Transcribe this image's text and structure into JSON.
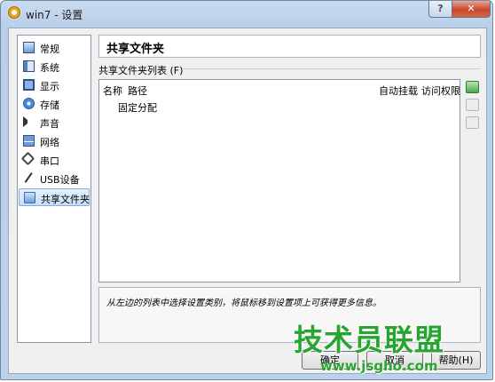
{
  "window": {
    "title": "win7 - 设置",
    "help_label": "?",
    "close_label": "✕"
  },
  "sidebar": {
    "items": [
      {
        "label": "常规",
        "icon": "general-icon"
      },
      {
        "label": "系统",
        "icon": "system-icon"
      },
      {
        "label": "显示",
        "icon": "display-icon"
      },
      {
        "label": "存储",
        "icon": "storage-icon"
      },
      {
        "label": "声音",
        "icon": "audio-icon"
      },
      {
        "label": "网络",
        "icon": "network-icon"
      },
      {
        "label": "串口",
        "icon": "serial-port-icon"
      },
      {
        "label": "USB设备",
        "icon": "usb-icon"
      },
      {
        "label": "共享文件夹",
        "icon": "folder-icon",
        "selected": true
      }
    ]
  },
  "main": {
    "section_title": "共享文件夹",
    "list_label": "共享文件夹列表 (F)",
    "columns": [
      "名称",
      "路径",
      "自动挂载",
      "访问权限"
    ],
    "rows": [
      {
        "name": "固定分配"
      }
    ],
    "tools": [
      "add-folder-icon",
      "edit-folder-icon",
      "remove-folder-icon"
    ]
  },
  "info": {
    "text": "从左边的列表中选择设置类别，将鼠标移到设置项上可获得更多信息。"
  },
  "buttons": {
    "ok": "确定",
    "cancel": "取消",
    "help": "帮助(H)"
  },
  "watermark": {
    "title": "技术员联盟",
    "url": "www.jsgho.com"
  },
  "colors": {
    "titlebar": "#bcd2ea",
    "selected": "#c8dff6",
    "close": "#c9462d",
    "watermark": "#27a52e"
  }
}
